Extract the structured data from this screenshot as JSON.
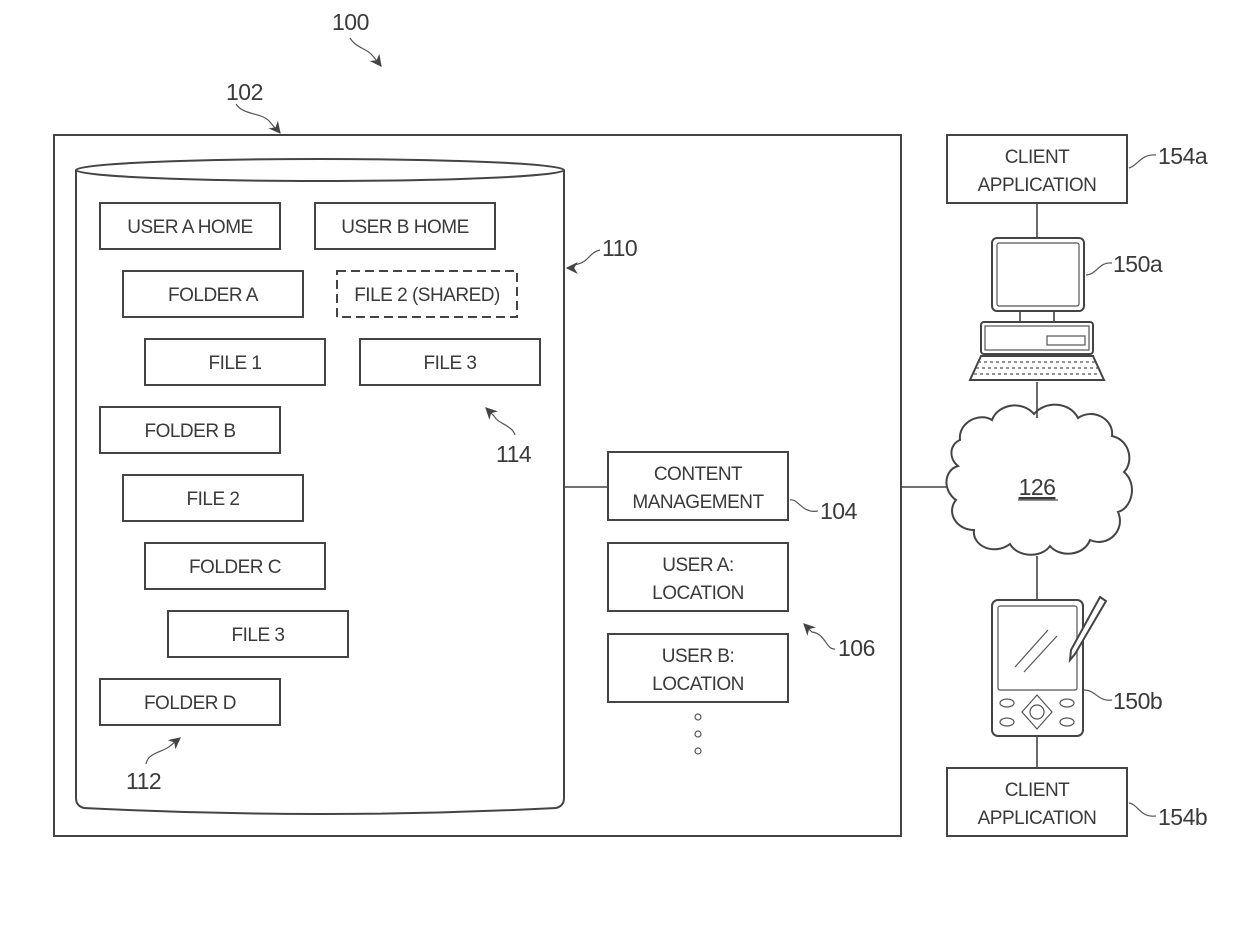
{
  "figure": {
    "ref_system": "100",
    "ref_server": "102",
    "ref_content_management": "104",
    "ref_user_locations": "106",
    "ref_storage": "110",
    "ref_tree_a": "112",
    "ref_tree_b": "114",
    "ref_network": "126",
    "ref_client_device_a": "150a",
    "ref_client_device_b": "150b",
    "ref_client_app_a": "154a",
    "ref_client_app_b": "154b"
  },
  "storage": {
    "items": [
      {
        "label": "USER A HOME",
        "style": "solid"
      },
      {
        "label": "USER B HOME",
        "style": "solid"
      },
      {
        "label": "FOLDER A",
        "style": "solid"
      },
      {
        "label": "FILE 2 (SHARED)",
        "style": "dashed"
      },
      {
        "label": "FILE 1",
        "style": "solid"
      },
      {
        "label": "FILE 3",
        "style": "solid"
      },
      {
        "label": "FOLDER B",
        "style": "solid"
      },
      {
        "label": "FILE 2",
        "style": "solid"
      },
      {
        "label": "FOLDER C",
        "style": "solid"
      },
      {
        "label": "FILE 3",
        "style": "solid"
      },
      {
        "label": "FOLDER D",
        "style": "solid"
      }
    ]
  },
  "server": {
    "content_management": {
      "line1": "CONTENT",
      "line2": "MANAGEMENT"
    },
    "user_a_location": {
      "line1": "USER A:",
      "line2": "LOCATION"
    },
    "user_b_location": {
      "line1": "USER B:",
      "line2": "LOCATION"
    }
  },
  "clients": {
    "app_a": {
      "line1": "CLIENT",
      "line2": "APPLICATION"
    },
    "app_b": {
      "line1": "CLIENT",
      "line2": "APPLICATION"
    }
  }
}
